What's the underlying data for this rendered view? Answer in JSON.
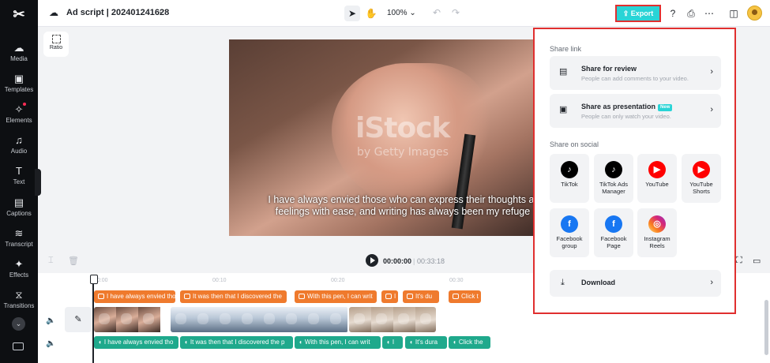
{
  "app": {
    "logo": "✂"
  },
  "sidebar": {
    "items": [
      {
        "label": "Media",
        "icon": "☁"
      },
      {
        "label": "Templates",
        "icon": "▣"
      },
      {
        "label": "Elements",
        "icon": "✧"
      },
      {
        "label": "Audio",
        "icon": "♫"
      },
      {
        "label": "Text",
        "icon": "T"
      },
      {
        "label": "Captions",
        "icon": "▤"
      },
      {
        "label": "Transcript",
        "icon": "≋"
      },
      {
        "label": "Effects",
        "icon": "✦"
      },
      {
        "label": "Transitions",
        "icon": "⧖"
      }
    ],
    "more_icon": "⌄",
    "collapse_icon": "›"
  },
  "header": {
    "project_title": "Ad script | 202401241628",
    "zoom": "100%",
    "export_label": "Export",
    "export_icon": "⇪"
  },
  "canvas": {
    "ratio_label": "Ratio",
    "watermark": "iStock",
    "watermark_sub": "by Getty Images",
    "subtitle_line1": "I have always envied those who can express their thoughts ar",
    "subtitle_line2": "feelings with ease, and writing has always been my refuge"
  },
  "player": {
    "current_time": "00:00:00",
    "separator": "|",
    "total_time": "00:33:18"
  },
  "timeline": {
    "ruler": [
      "00:00",
      "00:10",
      "00:20",
      "00:30"
    ],
    "text_clips": [
      {
        "label": "I have always envied tho"
      },
      {
        "label": "It was then that I discovered the"
      },
      {
        "label": "With this pen, I can writ"
      },
      {
        "label": "I"
      },
      {
        "label": "It's du"
      },
      {
        "label": "Click t"
      }
    ],
    "audio_clips": [
      {
        "label": "I have always envied tho"
      },
      {
        "label": "It was then that I discovered the p"
      },
      {
        "label": "With this pen, I can writ"
      },
      {
        "label": "I"
      },
      {
        "label": "It's dura"
      },
      {
        "label": "Click the"
      }
    ]
  },
  "share_panel": {
    "share_link_label": "Share link",
    "review": {
      "title": "Share for review",
      "desc": "People can add comments to your video."
    },
    "presentation": {
      "title": "Share as presentation",
      "badge": "New",
      "desc": "People can only watch your video."
    },
    "social_label": "Share on social",
    "social": [
      {
        "name": "TikTok",
        "glyph": "♪"
      },
      {
        "name": "TikTok Ads Manager",
        "glyph": "♪"
      },
      {
        "name": "YouTube",
        "glyph": "▶"
      },
      {
        "name": "YouTube Shorts",
        "glyph": "▶"
      },
      {
        "name": "Facebook group",
        "glyph": "f"
      },
      {
        "name": "Facebook Page",
        "glyph": "f"
      },
      {
        "name": "Instagram Reels",
        "glyph": "◎"
      }
    ],
    "download_label": "Download"
  },
  "colors": {
    "accent": "#29d4d6",
    "highlight_border": "#e02f2f",
    "text_clip": "#ef7a2d",
    "audio_clip": "#1fa98c"
  }
}
